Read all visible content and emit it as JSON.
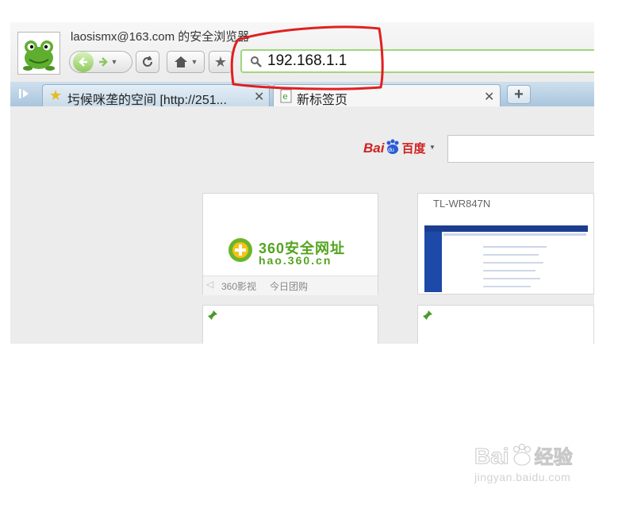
{
  "browser": {
    "account_label": "laosismx@163.com 的安全浏览器",
    "address_value": "192.168.1.1"
  },
  "tabs": [
    {
      "label": "圬候咪垄的空间 [http://251...",
      "active": false
    },
    {
      "label": "新标签页",
      "active": true
    }
  ],
  "search": {
    "engine_logo": "Bai百度",
    "engine_logo_left": "Bai",
    "engine_logo_right": "百度"
  },
  "speed_dial": [
    {
      "title": "",
      "logo_text": "360安全网址",
      "logo_url": "hao.360.cn",
      "links": [
        "360影视",
        "今日团购"
      ]
    },
    {
      "title": "TL-WR847N"
    },
    {
      "title": ""
    },
    {
      "title": ""
    }
  ],
  "watermark": {
    "logo": "Baidu经验",
    "logo_left": "Bai",
    "logo_right": "经验",
    "site": "jingyan.baidu.com"
  },
  "colors": {
    "annotation_red": "#e02020",
    "address_border": "#9fd77d",
    "tab_bar": "#b7cfe3",
    "logo_green": "#6bb52c"
  }
}
